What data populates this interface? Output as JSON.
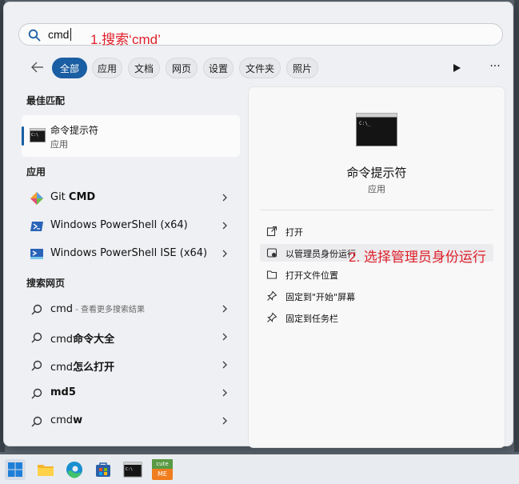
{
  "search": {
    "value": "cmd"
  },
  "annotations": {
    "step1": "1.搜索‘cmd’",
    "step2": "2. 选择管理员身份运行"
  },
  "filters": [
    "全部",
    "应用",
    "文档",
    "网页",
    "设置",
    "文件夹",
    "照片"
  ],
  "sections": {
    "best": "最佳匹配",
    "apps": "应用",
    "web": "搜索网页"
  },
  "best_match": {
    "title": "命令提示符",
    "subtitle": "应用"
  },
  "apps": [
    {
      "pre": "Git ",
      "bold": "CMD"
    },
    {
      "label": "Windows PowerShell (x64)"
    },
    {
      "label": "Windows PowerShell ISE (x64)"
    }
  ],
  "web": [
    {
      "pre": "cmd",
      "muted": " - 查看更多搜索结果"
    },
    {
      "pre": "cmd",
      "bold": "命令大全"
    },
    {
      "pre": "cmd",
      "bold": "怎么打开"
    },
    {
      "bold": "md5"
    },
    {
      "pre": "cmd",
      "bold": "w"
    }
  ],
  "detail": {
    "title": "命令提示符",
    "subtitle": "应用",
    "actions": [
      "打开",
      "以管理员身份运行",
      "打开文件位置",
      "固定到\"开始\"屏幕",
      "固定到任务栏"
    ]
  },
  "taskbar": {
    "cute_label": "cute",
    "me_label": "ME"
  },
  "colors": {
    "accent": "#1a5ea3",
    "annotation": "#e0202a"
  }
}
